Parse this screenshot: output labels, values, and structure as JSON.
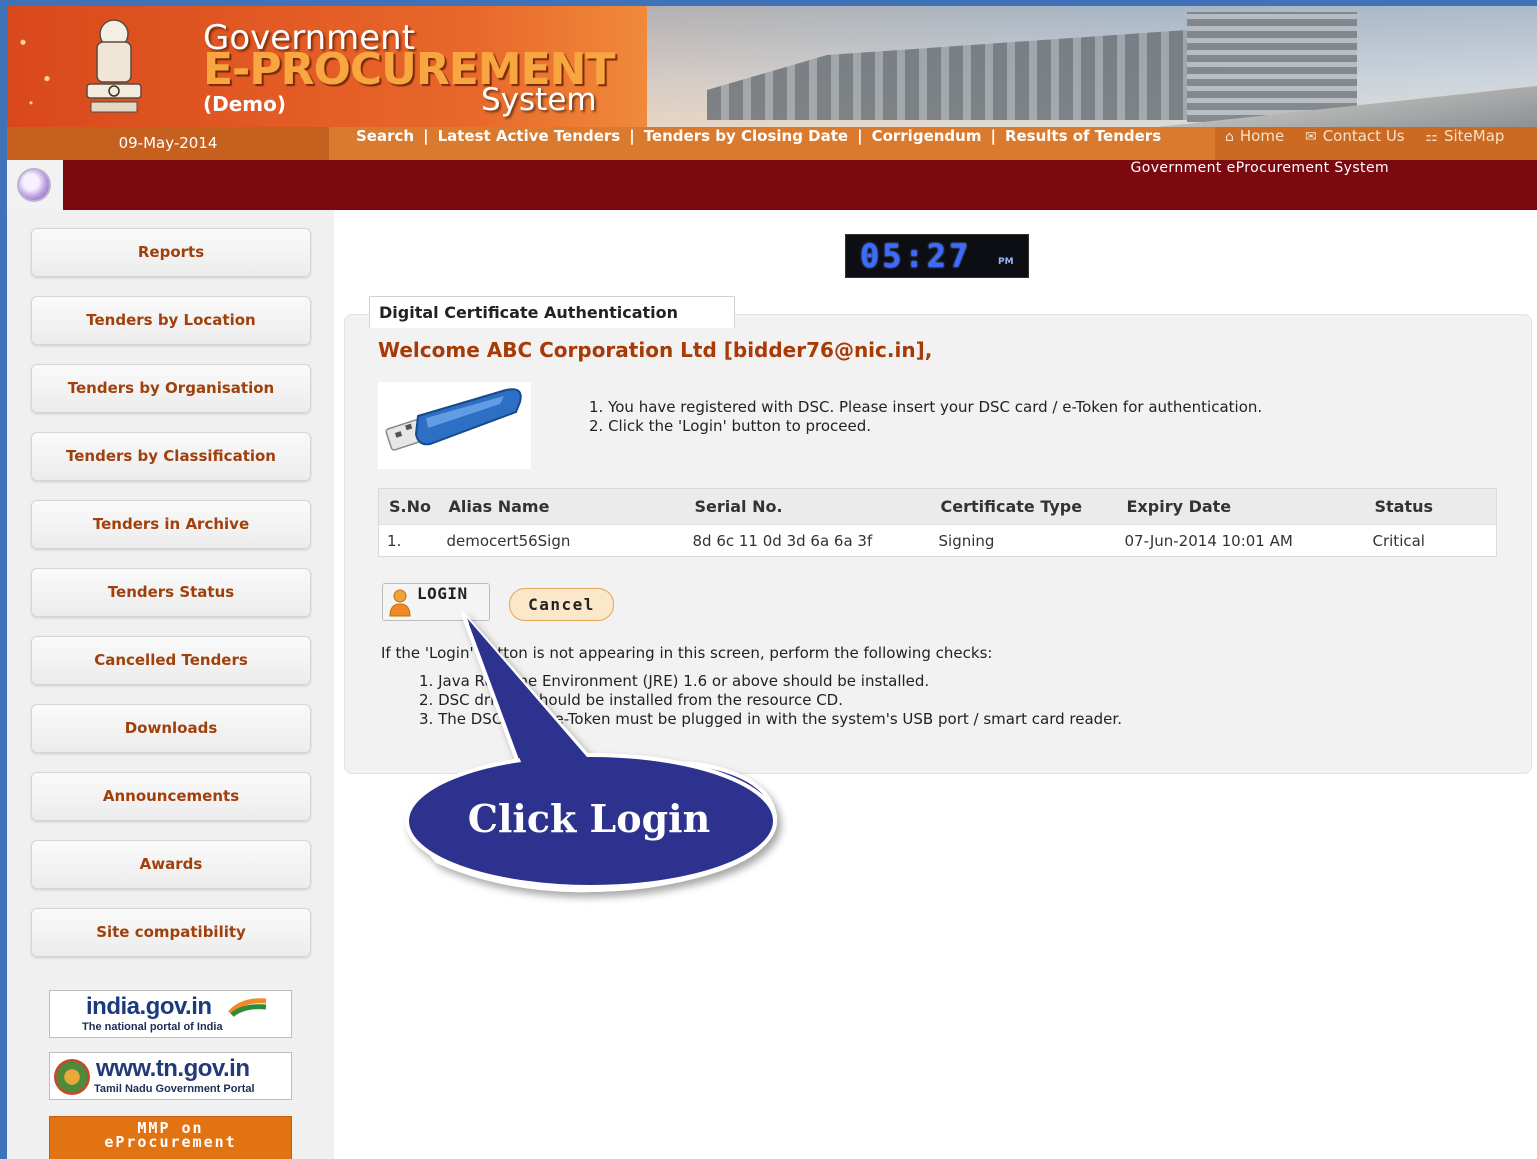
{
  "banner": {
    "title_line1": "Government",
    "title_line2": "E-PROCUREMENT",
    "title_line3": "System",
    "demo_label": "(Demo)"
  },
  "navbar": {
    "date": "09-May-2014",
    "links": [
      "Search",
      "Latest Active Tenders",
      "Tenders by Closing Date",
      "Corrigendum",
      "Results of Tenders"
    ],
    "separator": "|",
    "top_links": [
      {
        "icon": "home-icon",
        "glyph": "⌂",
        "label": "Home"
      },
      {
        "icon": "mail-icon",
        "glyph": "✉",
        "label": "Contact Us"
      },
      {
        "icon": "sitemap-icon",
        "glyph": "⚏",
        "label": "SiteMap"
      }
    ]
  },
  "strip": {
    "text": "Government eProcurement System"
  },
  "sidebar": {
    "menu": [
      "Reports",
      "Tenders by Location",
      "Tenders by Organisation",
      "Tenders by Classification",
      "Tenders in Archive",
      "Tenders Status",
      "Cancelled Tenders",
      "Downloads",
      "Announcements",
      "Awards",
      "Site compatibility"
    ],
    "portals": {
      "india": {
        "main": "india.gov.in",
        "sub": "The national portal of India"
      },
      "tn": {
        "main": "www.tn.gov.in",
        "sub": "Tamil Nadu Government Portal"
      },
      "mmp": {
        "line1": "MMP on",
        "line2": "eProcurement"
      }
    }
  },
  "clock": {
    "time": "05:27",
    "ampm": "PM"
  },
  "main": {
    "tab_title": "Digital Certificate Authentication",
    "welcome": "Welcome ABC Corporation Ltd [bidder76@nic.in],",
    "instructions": [
      "1.  You have registered with DSC. Please insert your DSC card / e-Token for authentication.",
      "2.  Click the 'Login' button to proceed."
    ],
    "table": {
      "headers": [
        "S.No",
        "Alias Name",
        "Serial No.",
        "Certificate Type",
        "Expiry Date",
        "Status"
      ],
      "rows": [
        [
          "1.",
          "democert56Sign",
          "8d 6c 11 0d 3d 6a 6a 3f",
          "Signing",
          "07-Jun-2014 10:01 AM",
          "Critical"
        ]
      ]
    },
    "login_label": "LOGIN",
    "cancel_label": "Cancel",
    "checks_intro": "If the 'Login' button is not appearing in this screen, perform the following checks:",
    "checks": [
      "1.  Java Runtime Environment (JRE) 1.6 or above should be installed.",
      "2.  DSC drivers should be installed from the resource CD.",
      "3.  The DSC card / e-Token must be plugged in with the system's USB port / smart card reader."
    ]
  },
  "callout": {
    "text": "Click Login",
    "fill": "#2e318f"
  },
  "colors": {
    "accent_brown": "#a0400c",
    "maroon": "#7b0a10",
    "orange": "#d97a2e"
  }
}
